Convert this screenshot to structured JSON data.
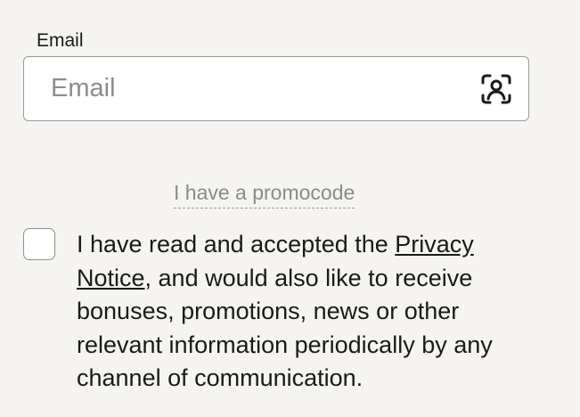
{
  "email": {
    "label": "Email",
    "placeholder": "Email",
    "value": "",
    "scan_icon": "face-scan-icon"
  },
  "promo": {
    "link_label": "I have a promocode"
  },
  "consent": {
    "checked": false,
    "text_before": "I have read and accepted the ",
    "link_label": "Privacy Notice",
    "text_after": ", and would also like to receive bonuses, promotions, news or other relevant information periodically by any channel of communication."
  }
}
